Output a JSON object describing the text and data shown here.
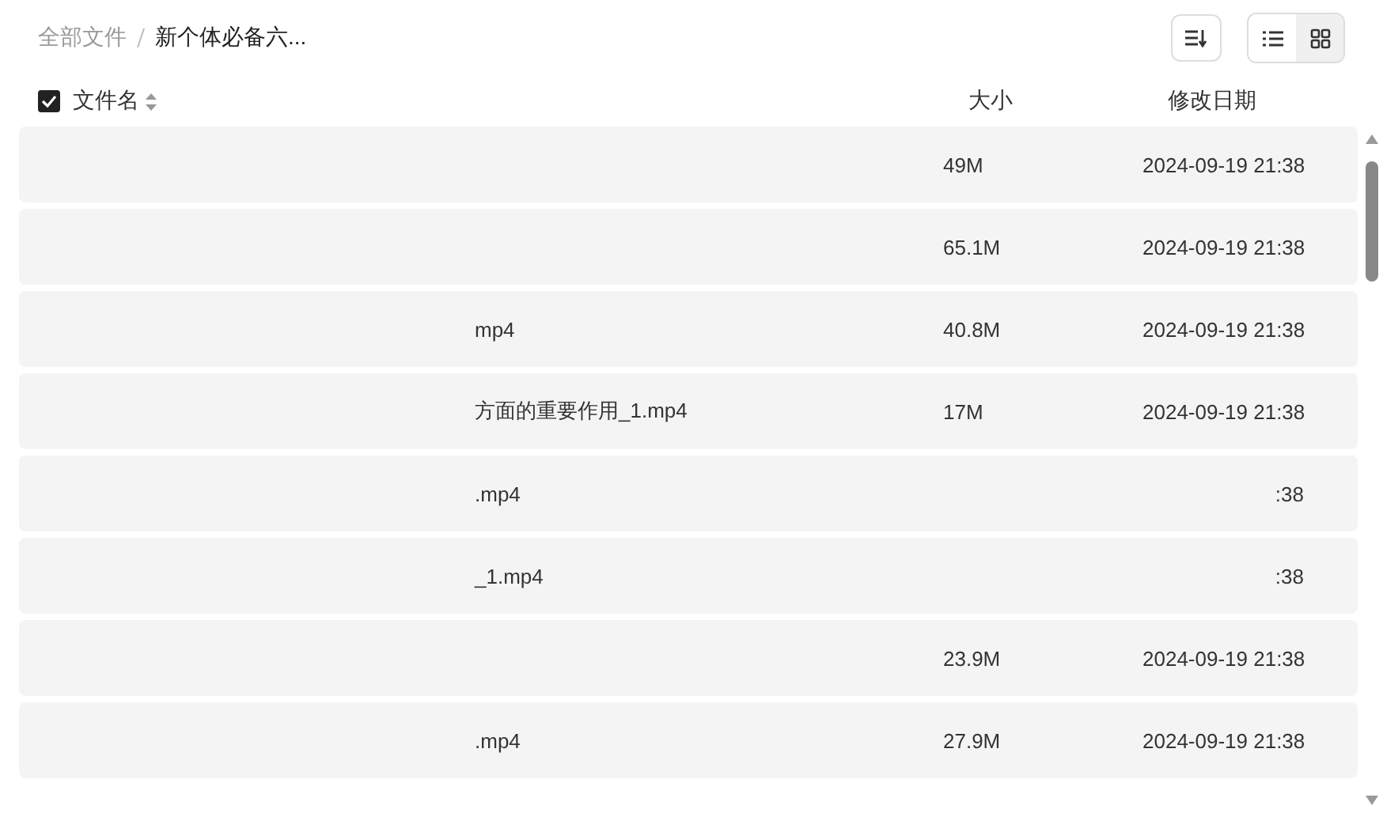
{
  "breadcrumb": [
    {
      "label": "全部文件",
      "current": false
    },
    {
      "label": "新个体必备六...",
      "current": true
    }
  ],
  "toolbar": {
    "view_modes": [
      {
        "kind": "list",
        "selected": false
      },
      {
        "kind": "grid",
        "selected": true
      }
    ]
  },
  "table": {
    "select_all": {
      "checked": true
    },
    "columns": [
      "文件名",
      "大小",
      "修改日期"
    ],
    "rows": [
      {
        "size": "49M",
        "modified": "2024-09-19 21:38"
      },
      {
        "size": "65.1M",
        "modified": "2024-09-19 21:38"
      },
      {
        "name": "mp4",
        "size": "40.8M",
        "modified": "2024-09-19 21:38"
      },
      {
        "name": "方面的重要作用_1.mp4",
        "size": "17M",
        "modified": "2024-09-19 21:38"
      },
      {
        "name": ".mp4",
        "modified": ":38"
      },
      {
        "name": "_1.mp4",
        "modified": ":38"
      },
      {
        "size": "23.9M",
        "modified": "2024-09-19 21:38"
      },
      {
        "name": ".mp4",
        "size": "27.9M",
        "modified": "2024-09-19 21:38"
      }
    ]
  }
}
